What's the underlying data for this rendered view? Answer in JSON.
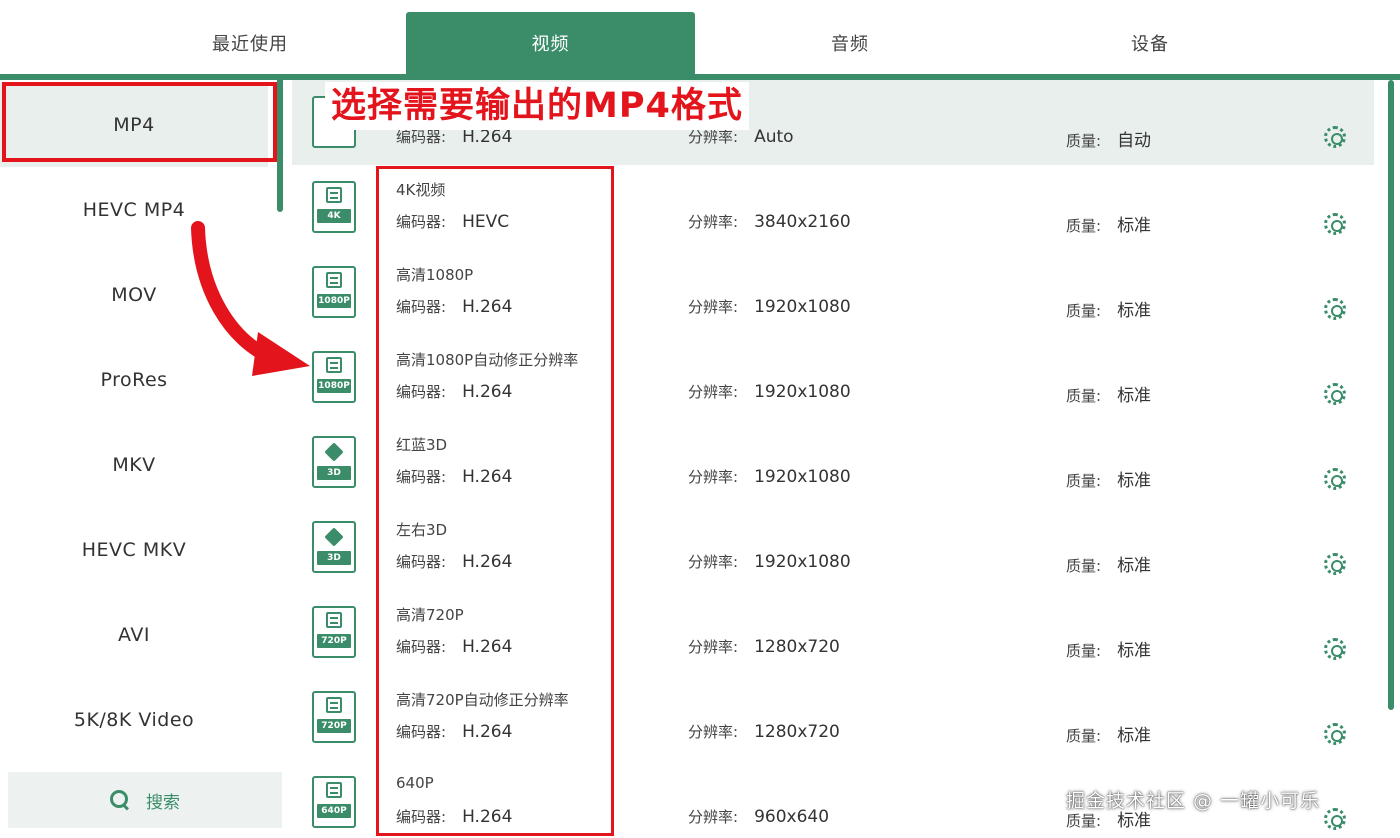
{
  "tabs": [
    {
      "label": "最近使用"
    },
    {
      "label": "视频"
    },
    {
      "label": "音频"
    },
    {
      "label": "设备"
    }
  ],
  "sidebar": {
    "items": [
      {
        "label": "MP4"
      },
      {
        "label": "HEVC MP4"
      },
      {
        "label": "MOV"
      },
      {
        "label": "ProRes"
      },
      {
        "label": "MKV"
      },
      {
        "label": "HEVC MKV"
      },
      {
        "label": "AVI"
      },
      {
        "label": "5K/8K Video"
      }
    ],
    "search_label": "搜索"
  },
  "labels": {
    "codec": "编码器:",
    "resolution": "分辨率:",
    "quality": "质量:"
  },
  "presets": [
    {
      "title": "",
      "badge": "",
      "codec": "H.264",
      "resolution": "Auto",
      "quality": "自动"
    },
    {
      "title": "4K视频",
      "badge": "4K",
      "codec": "HEVC",
      "resolution": "3840x2160",
      "quality": "标准"
    },
    {
      "title": "高清1080P",
      "badge": "1080P",
      "codec": "H.264",
      "resolution": "1920x1080",
      "quality": "标准"
    },
    {
      "title": "高清1080P自动修正分辨率",
      "badge": "1080P",
      "codec": "H.264",
      "resolution": "1920x1080",
      "quality": "标准"
    },
    {
      "title": "红蓝3D",
      "badge": "3D",
      "codec": "H.264",
      "resolution": "1920x1080",
      "quality": "标准"
    },
    {
      "title": "左右3D",
      "badge": "3D",
      "codec": "H.264",
      "resolution": "1920x1080",
      "quality": "标准"
    },
    {
      "title": "高清720P",
      "badge": "720P",
      "codec": "H.264",
      "resolution": "1280x720",
      "quality": "标准"
    },
    {
      "title": "高清720P自动修正分辨率",
      "badge": "720P",
      "codec": "H.264",
      "resolution": "1280x720",
      "quality": "标准"
    },
    {
      "title": "640P",
      "badge": "640P",
      "codec": "H.264",
      "resolution": "960x640",
      "quality": "标准"
    }
  ],
  "annotation": {
    "text": "选择需要输出的MP4格式"
  },
  "watermark": "掘金技术社区 @ 一罐小可乐",
  "colors": {
    "accent": "#3b8d6a",
    "annotation": "#e3141c",
    "selected_bg": "#e9efec"
  }
}
